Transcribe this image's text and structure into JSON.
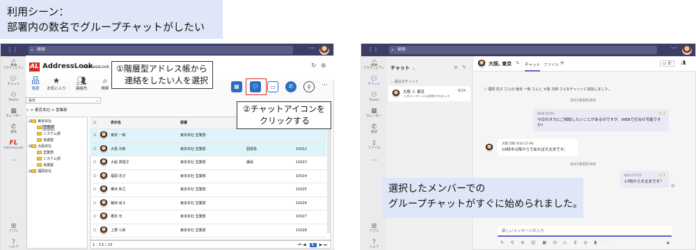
{
  "caption": {
    "line1": "利用シーン：",
    "line2": "部署内の数名でグループチャットがしたい"
  },
  "left": {
    "search_placeholder": "検索",
    "rail": [
      "アクティビティ",
      "チャット",
      "Teams",
      "カレンダー",
      "通話",
      "AddressLook",
      "…"
    ],
    "rail_bottom": [
      "アプリ",
      "ヘルプ"
    ],
    "app": {
      "logo": "AL",
      "title": "AddressLook",
      "subtitle": "AddressLook",
      "toolbar": [
        "階層",
        "お気に入り",
        "連絡先",
        "検索"
      ],
      "company": "会社",
      "breadcrumb": "> 東京本社 > 営業部",
      "tree": [
        "東京本社",
        "営業部",
        "システム部",
        "会議室",
        "大阪本社",
        "営業部",
        "システム部",
        "会議室",
        "福岡本社"
      ],
      "columns": [
        "表示名",
        "部署",
        "",
        "役職",
        "内線"
      ],
      "rows": [
        {
          "name": "東京 一郎",
          "dept": "東京本社 営業部",
          "title": "",
          "ext": ""
        },
        {
          "name": "大阪 次郎",
          "dept": "東京本社 営業部",
          "title": "副部長",
          "ext": "10022"
        },
        {
          "name": "大船 真理子",
          "dept": "東京本社 営業部",
          "title": "課長",
          "ext": "10023"
        },
        {
          "name": "福岡 花子",
          "dept": "東京本社 営業部",
          "title": "",
          "ext": "10024"
        },
        {
          "name": "横浜 和之",
          "dept": "東京本社 営業部",
          "title": "",
          "ext": "10025"
        },
        {
          "name": "藤田 尚子",
          "dept": "東京本社 営業部",
          "title": "",
          "ext": "10026"
        },
        {
          "name": "橋本 光",
          "dept": "東京本社 営業部",
          "title": "",
          "ext": "10027"
        },
        {
          "name": "上野 三郎",
          "dept": "東京本社 営業部",
          "title": "",
          "ext": "10028"
        }
      ],
      "paging": "1 - 13 / 13",
      "step1": [
        "①階層型アドレス帳から",
        "連絡をしたい人を選択"
      ],
      "step2": [
        "②チャットアイコンを",
        "クリックする"
      ]
    }
  },
  "right": {
    "search_placeholder": "検索",
    "rail": [
      "アクティビティ",
      "チャット",
      "Teams",
      "カレンダー",
      "通話",
      "ファイル",
      "…"
    ],
    "rail_bottom": [
      "アプリ",
      "ヘルプ"
    ],
    "chat_title": "チャット",
    "recent": "最近のチャット",
    "chat_item": {
      "name": "大阪 と 東京",
      "preview": "このメッセージは削除されました",
      "date": "8/24"
    },
    "header": {
      "name": "大阪, 東京",
      "tab_chat": "チャット",
      "tab_file": "ファイル",
      "add": "+"
    },
    "system_msg": "福岡 花子 さんが 東京 一郎 さんと 大阪 次郎 さんをチャットに追加しました。",
    "date1": "2021年8月18日",
    "msg1": {
      "time": "8/18 15:01",
      "text": "今日のタカにご相談したいことがあるのですが、WEBで打合せ可能ですか?",
      "likes": "1"
    },
    "msg2": {
      "sender": "大阪 次郎",
      "time": "8/18 15:06",
      "text": "16時半以降からであれば大丈夫です。"
    },
    "date2": "2021年8月24日",
    "msg3": {
      "time": "8/24 17:51",
      "text": "17時から大丈夫です！",
      "likes": "1"
    },
    "input_placeholder": "新しいメッセージの入力",
    "overlay": [
      "選択したメンバーでの",
      "グループチャットがすぐに始められました。"
    ]
  }
}
